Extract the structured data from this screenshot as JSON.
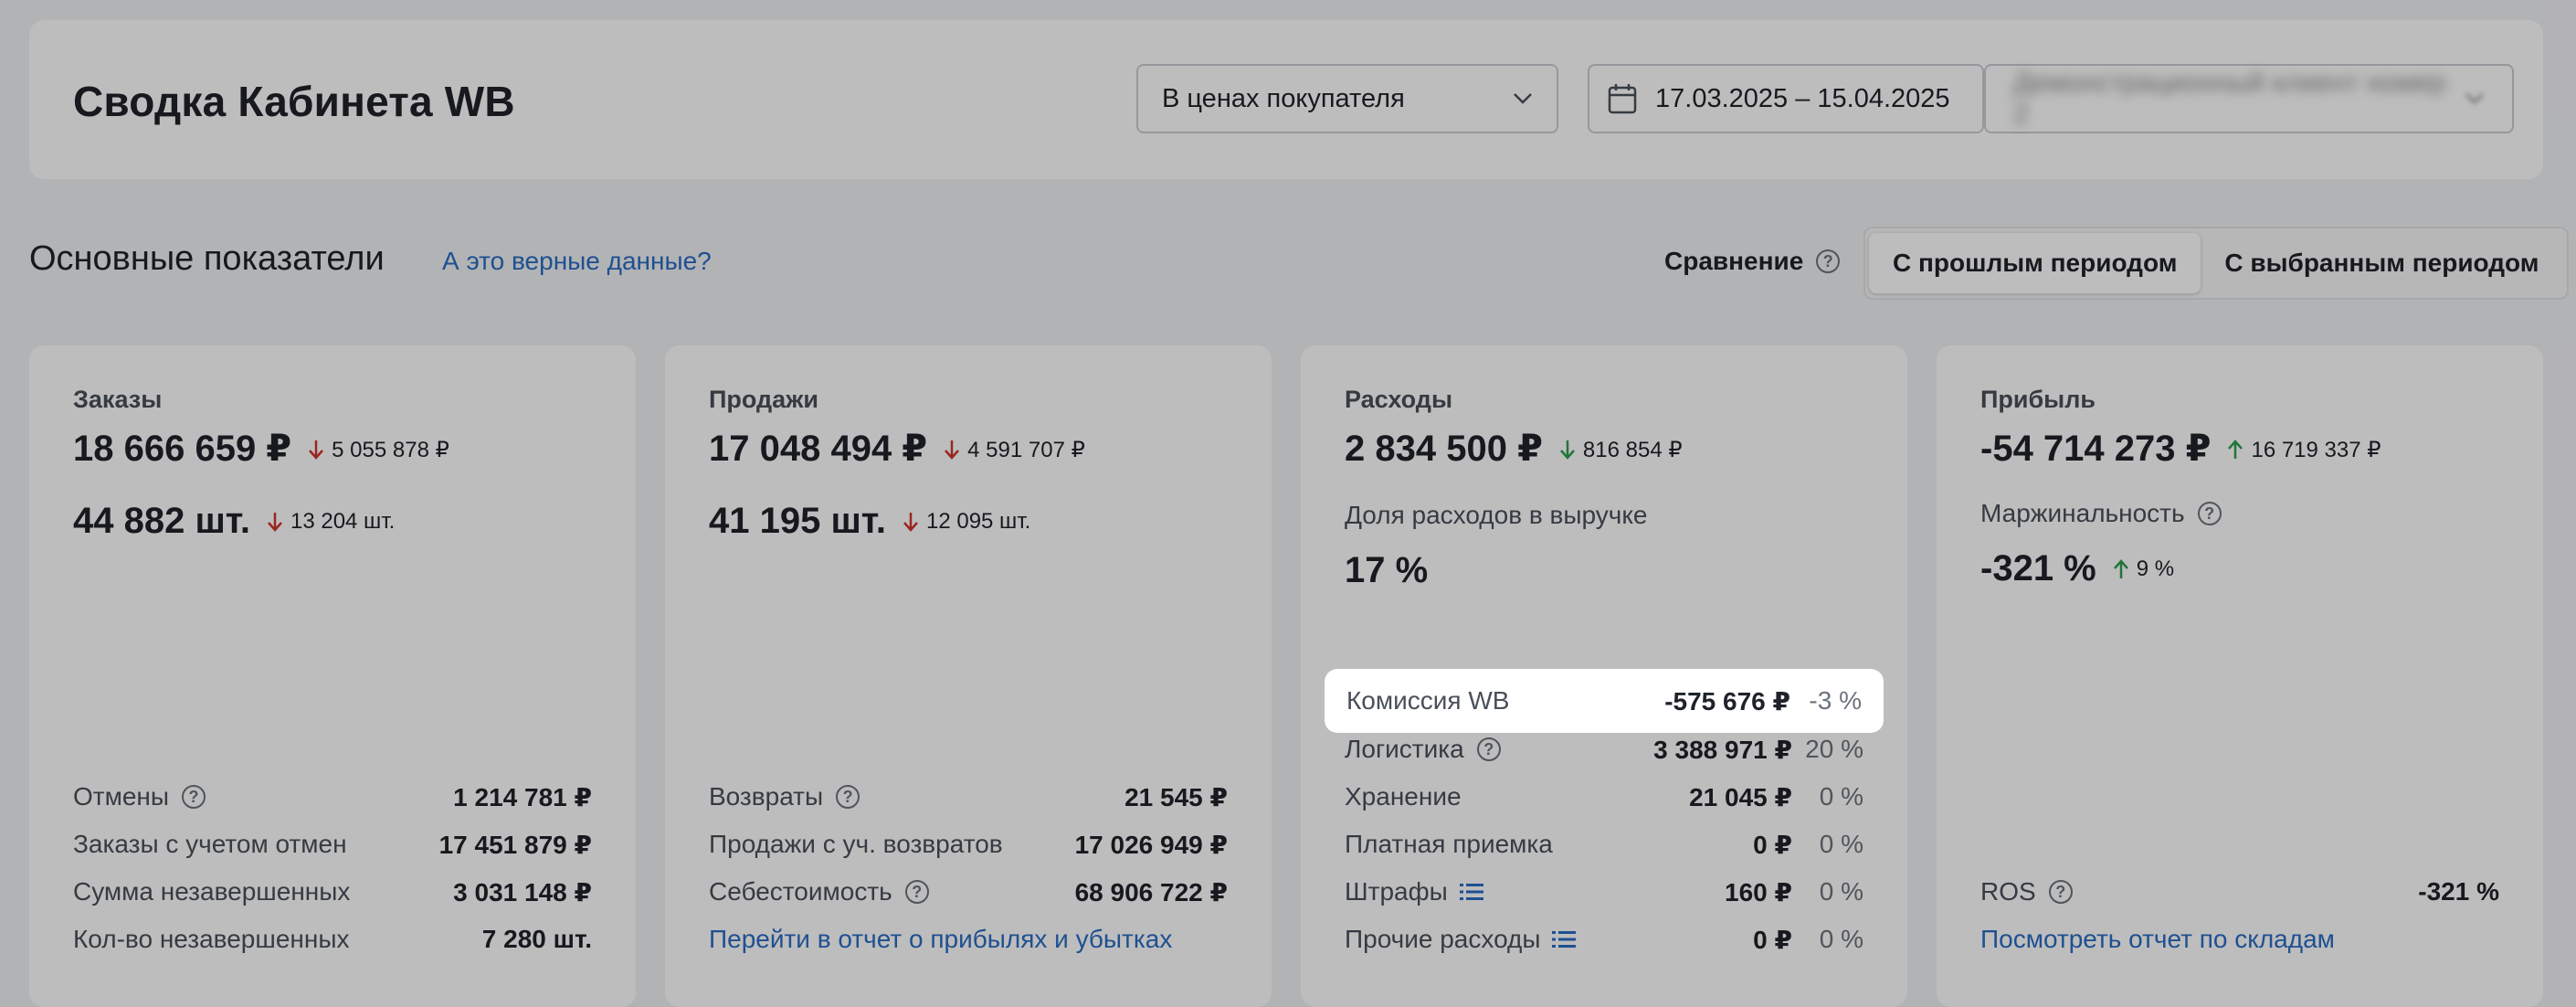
{
  "header": {
    "title": "Сводка Кабинета WB",
    "price_mode": "В ценах покупателя",
    "date_range": "17.03.2025 – 15.04.2025",
    "client": "Демонстрационный клиент номер 2"
  },
  "section": {
    "title": "Основные показатели",
    "verify_link": "А это верные данные?",
    "compare_label": "Сравнение",
    "compare_prev": "С прошлым периодом",
    "compare_selected": "С выбранным периодом"
  },
  "orders": {
    "label": "Заказы",
    "amount": "18 666 659 ₽",
    "amount_delta": "5 055 878 ₽",
    "count": "44 882 шт.",
    "count_delta": "13 204 шт.",
    "rows": [
      {
        "label": "Отмены",
        "value": "1 214 781 ₽"
      },
      {
        "label": "Заказы с учетом отмен",
        "value": "17 451 879 ₽"
      },
      {
        "label": "Сумма незавершенных",
        "value": "3 031 148 ₽"
      },
      {
        "label": "Кол-во незавершенных",
        "value": "7 280 шт."
      }
    ]
  },
  "sales": {
    "label": "Продажи",
    "amount": "17 048 494 ₽",
    "amount_delta": "4 591 707 ₽",
    "count": "41 195 шт.",
    "count_delta": "12 095 шт.",
    "rows": [
      {
        "label": "Возвраты",
        "value": "21 545 ₽"
      },
      {
        "label": "Продажи с уч. возвратов",
        "value": "17 026 949 ₽"
      },
      {
        "label": "Себестоимость",
        "value": "68 906 722 ₽"
      }
    ],
    "link": "Перейти в отчет о прибылях и убытках"
  },
  "expenses": {
    "label": "Расходы",
    "amount": "2 834 500 ₽",
    "amount_delta": "816 854 ₽",
    "share_label": "Доля расходов в выручке",
    "share_value": "17 %",
    "rows": [
      {
        "label": "Комиссия WB",
        "value": "-575 676 ₽",
        "pct": "-3 %"
      },
      {
        "label": "Логистика",
        "value": "3 388 971 ₽",
        "pct": "20 %"
      },
      {
        "label": "Хранение",
        "value": "21 045 ₽",
        "pct": "0 %"
      },
      {
        "label": "Платная приемка",
        "value": "0 ₽",
        "pct": "0 %"
      },
      {
        "label": "Штрафы",
        "value": "160 ₽",
        "pct": "0 %"
      },
      {
        "label": "Прочие расходы",
        "value": "0 ₽",
        "pct": "0 %"
      }
    ]
  },
  "profit": {
    "label": "Прибыль",
    "amount": "-54 714 273 ₽",
    "amount_delta": "16 719 337 ₽",
    "margin_label": "Маржинальность",
    "margin_value": "-321 %",
    "margin_delta": "9 %",
    "ros_label": "ROS",
    "ros_value": "-321 %",
    "link": "Посмотреть отчет по складам"
  },
  "colors": {
    "down": "#d0342c",
    "up": "#2e9e4f",
    "link": "#2b6cc4"
  }
}
